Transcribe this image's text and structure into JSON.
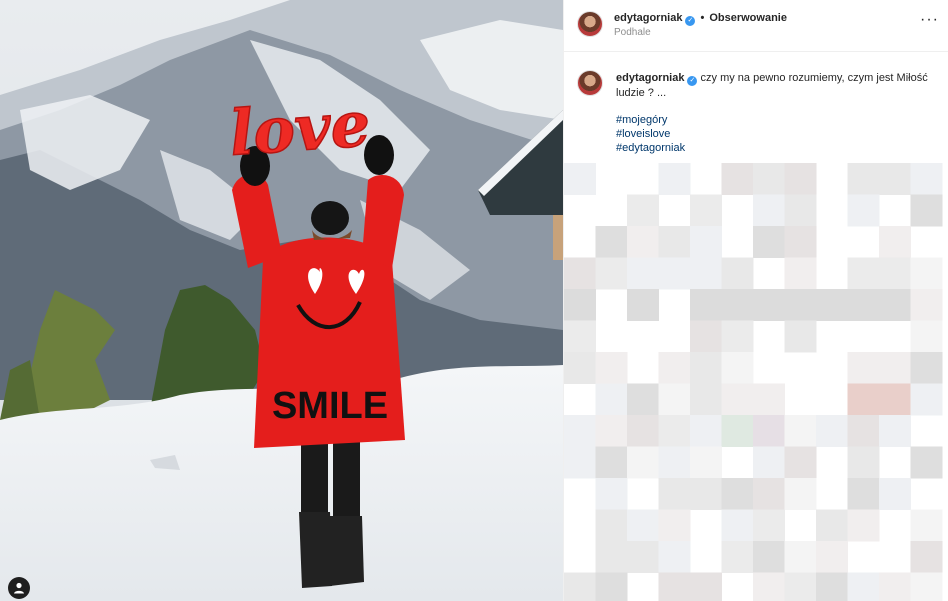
{
  "post": {
    "username": "edytagorniak",
    "verified_glyph": "✓",
    "separator": "•",
    "follow_label": "Obserwowanie",
    "location": "Podhale",
    "more_icon": "more-horizontal-icon",
    "caption_text": "czy my na pewno rozumiemy, czym jest Miłość ludzie ? ...",
    "hashtags": [
      "#mojegóry",
      "#loveislove",
      "#edytagorniak"
    ]
  },
  "photo": {
    "balloon_text": "love",
    "coat_text": "SMILE",
    "tag_icon": "user-tag-icon"
  },
  "colors": {
    "accent_red": "#e8231f",
    "link_blue": "#00376b",
    "verified_blue": "#3897f0",
    "muted_text": "#8e8e8e"
  }
}
